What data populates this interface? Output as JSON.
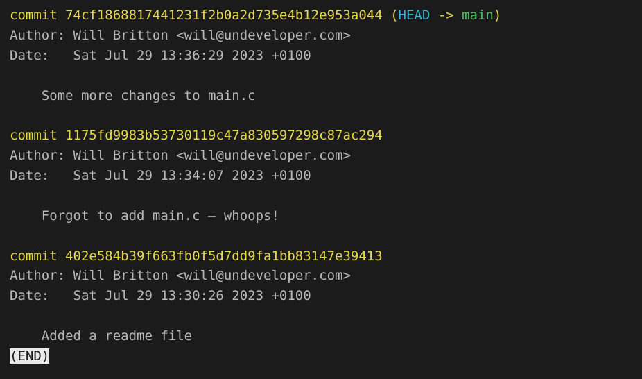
{
  "commits": [
    {
      "hash": "74cf1868817441231f2b0a2d735e4b12e953a044",
      "has_ref": true,
      "head_label": "HEAD",
      "arrow": " -> ",
      "branch": "main",
      "author_label": "Author: ",
      "author": "Will Britton <will@undeveloper.com>",
      "date_label": "Date:   ",
      "date": "Sat Jul 29 13:36:29 2023 +0100",
      "message": "Some more changes to main.c"
    },
    {
      "hash": "1175fd9983b53730119c47a830597298c87ac294",
      "has_ref": false,
      "author_label": "Author: ",
      "author": "Will Britton <will@undeveloper.com>",
      "date_label": "Date:   ",
      "date": "Sat Jul 29 13:34:07 2023 +0100",
      "message": "Forgot to add main.c — whoops!"
    },
    {
      "hash": "402e584b39f663fb0f5d7dd9fa1bb83147e39413",
      "has_ref": false,
      "author_label": "Author: ",
      "author": "Will Britton <will@undeveloper.com>",
      "date_label": "Date:   ",
      "date": "Sat Jul 29 13:30:26 2023 +0100",
      "message": "Added a readme file"
    }
  ],
  "commit_word": "commit ",
  "paren_open": " (",
  "paren_close": ")",
  "end_marker": "(END)"
}
